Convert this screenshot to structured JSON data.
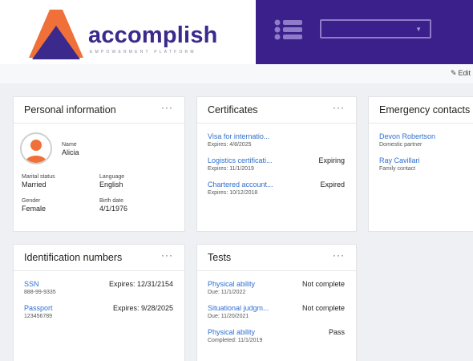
{
  "header": {
    "brand": "accomplish",
    "tagline": "EMPOWERMENT PLATFORM",
    "colors": {
      "brand_purple": "#3b1f8a",
      "logo_orange": "#f0703a",
      "link_blue": "#2f6fd1"
    }
  },
  "toolbar": {
    "edit_label": "Edit"
  },
  "personal": {
    "title": "Personal information",
    "more": "···",
    "name_label": "Name",
    "name": "Alicia",
    "marital_label": "Marital status",
    "marital": "Married",
    "language_label": "Language",
    "language": "English",
    "gender_label": "Gender",
    "gender": "Female",
    "birth_label": "Birth date",
    "birth": "4/1/1976"
  },
  "certificates": {
    "title": "Certificates",
    "more": "···",
    "items": [
      {
        "name": "Visa for internatio...",
        "sub": "Expires: 4/8/2025",
        "status": ""
      },
      {
        "name": "Logistics certificati...",
        "sub": "Expires: 11/1/2019",
        "status": "Expiring"
      },
      {
        "name": "Chartered account...",
        "sub": "Expires: 10/12/2018",
        "status": "Expired"
      }
    ]
  },
  "emergency": {
    "title": "Emergency contacts",
    "items": [
      {
        "name": "Devon Robertson",
        "sub": "Domestic partner"
      },
      {
        "name": "Ray Cavillari",
        "sub": "Family contact"
      }
    ]
  },
  "identification": {
    "title": "Identification numbers",
    "more": "···",
    "items": [
      {
        "name": "SSN",
        "sub": "888-99-9335",
        "status": "Expires: 12/31/2154"
      },
      {
        "name": "Passport",
        "sub": "123456789",
        "status": "Expires: 9/28/2025"
      }
    ]
  },
  "tests": {
    "title": "Tests",
    "more": "···",
    "items": [
      {
        "name": "Physical ability",
        "sub": "Due: 11/1/2022",
        "status": "Not complete"
      },
      {
        "name": "Situational judgm...",
        "sub": "Due: 11/20/2021",
        "status": "Not complete"
      },
      {
        "name": "Physical ability",
        "sub": "Completed: 11/1/2019",
        "status": "Pass"
      }
    ]
  }
}
